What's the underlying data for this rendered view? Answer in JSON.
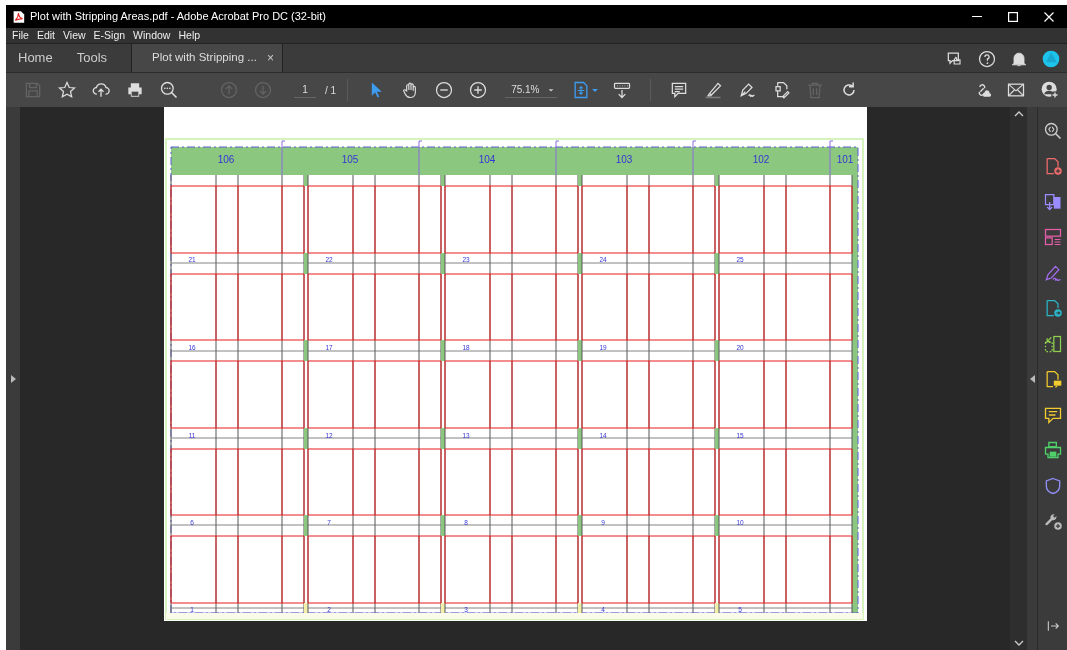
{
  "window": {
    "title": "Plot with Stripping Areas.pdf - Adobe Acrobat Pro DC (32-bit)"
  },
  "menu": [
    "File",
    "Edit",
    "View",
    "E-Sign",
    "Window",
    "Help"
  ],
  "tabs": [
    {
      "label": "Home",
      "selected": false,
      "closable": false
    },
    {
      "label": "Tools",
      "selected": false,
      "closable": false
    },
    {
      "label": "Plot with Stripping ...",
      "selected": true,
      "closable": true,
      "close": "×"
    }
  ],
  "toolbar": [
    {
      "kind": "save",
      "disabled": true
    },
    {
      "kind": "star",
      "disabled": false
    },
    {
      "kind": "upload",
      "disabled": false
    },
    {
      "kind": "print",
      "disabled": false
    },
    {
      "kind": "find",
      "disabled": false
    },
    {
      "kind": "prev",
      "disabled": true
    },
    {
      "kind": "next",
      "disabled": true
    },
    {
      "kind": "page"
    },
    {
      "kind": "sep"
    },
    {
      "kind": "select",
      "disabled": false
    },
    {
      "kind": "hand",
      "disabled": false
    },
    {
      "kind": "zoomout",
      "disabled": false
    },
    {
      "kind": "zoomin",
      "disabled": false
    },
    {
      "kind": "zoom"
    },
    {
      "kind": "fit",
      "disabled": false
    },
    {
      "kind": "scroll",
      "disabled": false
    },
    {
      "kind": "sep"
    },
    {
      "kind": "comment",
      "disabled": false
    },
    {
      "kind": "highlight",
      "disabled": false
    },
    {
      "kind": "sign",
      "disabled": false
    },
    {
      "kind": "edit",
      "disabled": false
    },
    {
      "kind": "trash",
      "disabled": true
    },
    {
      "kind": "rotate",
      "disabled": false
    }
  ],
  "page_field": {
    "value": "1",
    "total": "/ 1"
  },
  "zoom_field": {
    "value": "75.1%"
  },
  "document": {
    "header_labels": [
      "106",
      "105",
      "104",
      "103",
      "102",
      "101"
    ],
    "area_rows": [
      {
        "numbers": [
          "21",
          "22",
          "23",
          "24",
          "25"
        ]
      },
      {
        "numbers": [
          "16",
          "17",
          "18",
          "19",
          "20"
        ]
      },
      {
        "numbers": [
          "11",
          "12",
          "13",
          "14",
          "15"
        ]
      },
      {
        "numbers": [
          "6",
          "7",
          "8",
          "9",
          "10"
        ]
      },
      {
        "numbers": [
          "1",
          "2",
          "3",
          "4",
          "5"
        ]
      }
    ]
  }
}
